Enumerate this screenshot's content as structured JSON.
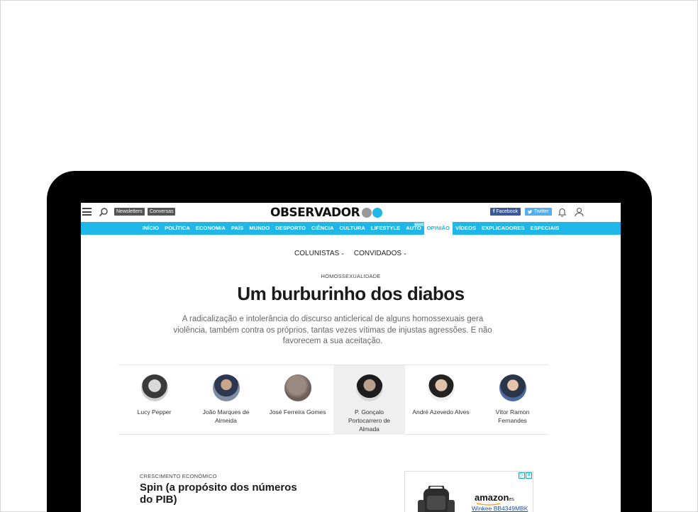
{
  "header": {
    "newsletters_label": "Newsletters",
    "conversas_label": "Conversas",
    "logo_text": "OBSERVADOR",
    "facebook_label": "Facebook",
    "twitter_label": "Twitter"
  },
  "nav": {
    "items": [
      {
        "label": "INÍCIO"
      },
      {
        "label": "POLÍTICA"
      },
      {
        "label": "ECONOMIA"
      },
      {
        "label": "PAÍS"
      },
      {
        "label": "MUNDO"
      },
      {
        "label": "DESPORTO"
      },
      {
        "label": "CIÊNCIA"
      },
      {
        "label": "CULTURA"
      },
      {
        "label": "LIFESTYLE"
      },
      {
        "label": "AUTO",
        "badge": "NOVO"
      },
      {
        "label": "OPINIÃO",
        "active": true
      },
      {
        "label": "VÍDEOS"
      },
      {
        "label": "EXPLICADORES"
      },
      {
        "label": "ESPECIAIS"
      }
    ]
  },
  "subnav": {
    "colunistas": "COLUNISTAS",
    "convidados": "CONVIDADOS"
  },
  "article": {
    "category": "HOMOSSEXUALIDADE",
    "title": "Um burburinho dos diabos",
    "lead": "A radicalização e intolerância do discurso anticlerical de alguns homossexuais gera violência, também contra os próprios, tantas vezes vítimas de injustas agressões. E não favorecem a sua aceitação."
  },
  "authors": [
    {
      "name": "Lucy Pepper"
    },
    {
      "name": "João Marques de Almeida"
    },
    {
      "name": "José Ferreira Gomes"
    },
    {
      "name": "P. Gonçalo Portocarrero de Almada",
      "active": true
    },
    {
      "name": "André Azevedo Alves"
    },
    {
      "name": "Vítor Ramon Fernandes"
    }
  ],
  "teaser": {
    "category": "CRESCIMENTO ECONÓMICO",
    "title": "Spin (a propósito dos números do PIB)"
  },
  "ad": {
    "brand": "amazon",
    "brand_suffix": "es",
    "product": "Winkee BB4349MBK"
  },
  "colors": {
    "accent": "#1fb6e8",
    "facebook": "#3b5998",
    "twitter": "#55acee"
  }
}
